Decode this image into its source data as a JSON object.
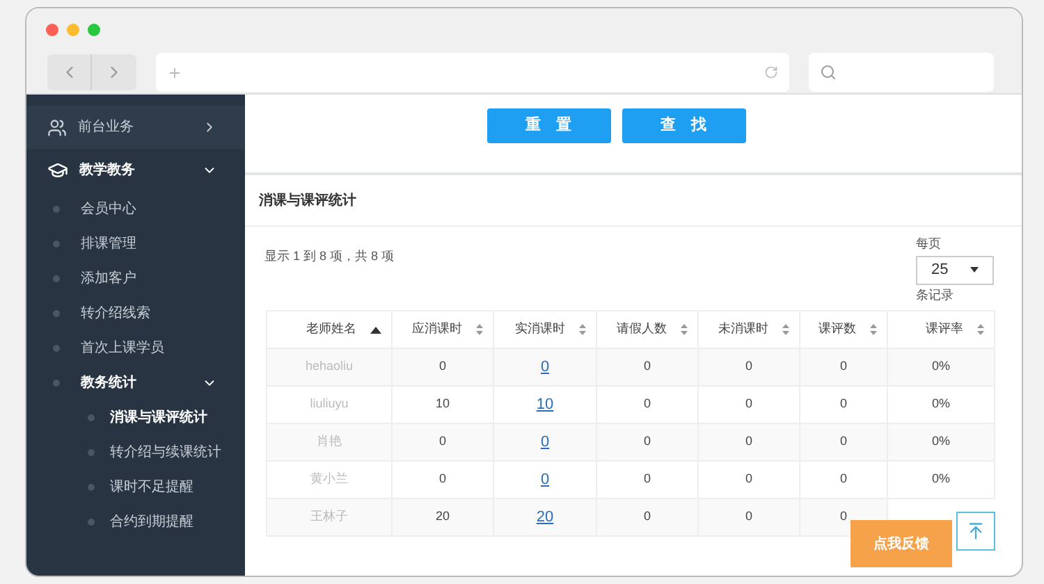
{
  "sidebar": {
    "items": [
      {
        "label": "前台业务",
        "expanded": false
      },
      {
        "label": "教学教务",
        "expanded": true,
        "children": [
          {
            "label": "会员中心",
            "selected": false
          },
          {
            "label": "排课管理",
            "selected": false
          },
          {
            "label": "添加客户",
            "selected": false
          },
          {
            "label": "转介绍线索",
            "selected": false
          },
          {
            "label": "首次上课学员",
            "selected": false
          },
          {
            "label": "教务统计",
            "selected": false,
            "expanded": true,
            "children": [
              {
                "label": "消课与课评统计",
                "selected": true
              },
              {
                "label": "转介绍与续课统计",
                "selected": false
              },
              {
                "label": "课时不足提醒",
                "selected": false
              },
              {
                "label": "合约到期提醒",
                "selected": false
              }
            ]
          }
        ]
      }
    ]
  },
  "buttons": [
    "重　置",
    "查　找"
  ],
  "panel": {
    "title": "消课与课评统计",
    "summary": "显示 1 到 8 项，共 8 项",
    "page_size_label": "每页",
    "page_size": "25",
    "page_size_suffix": "条记录"
  },
  "table": {
    "columns": [
      {
        "label": "老师姓名",
        "sorted": true
      },
      {
        "label": "应消课时",
        "sorted": false
      },
      {
        "label": "实消课时",
        "sorted": false
      },
      {
        "label": "请假人数",
        "sorted": false
      },
      {
        "label": "未消课时",
        "sorted": false
      },
      {
        "label": "课评数",
        "sorted": false
      },
      {
        "label": "课评率",
        "sorted": false
      }
    ],
    "rows": [
      [
        "hehaoliu",
        "0",
        "0",
        "0",
        "0",
        "0",
        "0%"
      ],
      [
        "liuliuyu",
        "10",
        "10",
        "0",
        "0",
        "0",
        "0%"
      ],
      [
        "肖艳",
        "0",
        "0",
        "0",
        "0",
        "0",
        "0%"
      ],
      [
        "黄小兰",
        "0",
        "0",
        "0",
        "0",
        "0",
        "0%"
      ],
      [
        "王林子",
        "20",
        "20",
        "0",
        "0",
        "0"
      ]
    ]
  },
  "feedback_button": "点我反馈"
}
